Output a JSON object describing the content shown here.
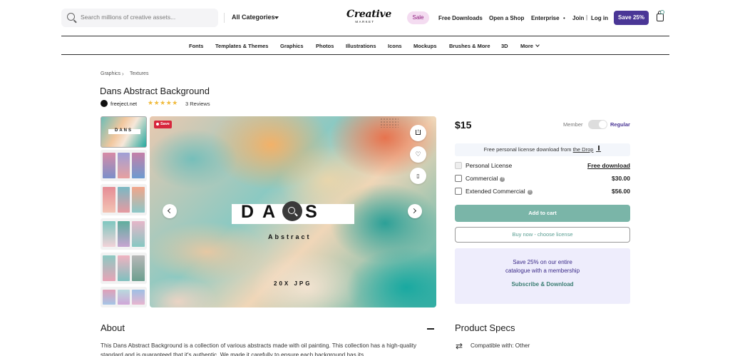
{
  "header": {
    "search_placeholder": "Search millions of creative assets...",
    "category": "All Categories",
    "logo_main": "Creative",
    "logo_sub": "MARKET",
    "sale": "Sale",
    "links": [
      "Free Downloads",
      "Open a Shop",
      "Enterprise"
    ],
    "dot": "•",
    "join": "Join",
    "pipe": "|",
    "login": "Log in",
    "save_cta": "Save 25%"
  },
  "nav": [
    "Fonts",
    "Templates & Themes",
    "Graphics",
    "Photos",
    "Illustrations",
    "Icons",
    "Mockups",
    "Brushes & More",
    "3D",
    "More"
  ],
  "breadcrumb": [
    "Graphics",
    "Textures"
  ],
  "breadcrumb_sep": "›",
  "product": {
    "title": "Dans Abstract Background",
    "shop": "freeject.net",
    "stars": "★★★★★",
    "rating": 5,
    "reviews": "3 Reviews",
    "sale_tag": "Save",
    "image_title": "DANS",
    "image_subtitle": "Abstract",
    "image_format": "20X JPG",
    "thumb_title": "DANS"
  },
  "purchase": {
    "price": "$15",
    "member_label": "Member",
    "regular_label": "Regular",
    "free_note_prefix": "Free personal license download from ",
    "free_note_link": "the Drop",
    "licenses": [
      {
        "label": "Personal License",
        "price": "Free download",
        "info": false
      },
      {
        "label": "Commercial",
        "price": "$30.00",
        "info": true
      },
      {
        "label": "Extended Commercial",
        "price": "$56.00",
        "info": true
      }
    ],
    "info_glyph": "?",
    "add_to_cart": "Add to cart",
    "buy_now": "Buy now - choose license",
    "promo_line1": "Save 25% on our entire",
    "promo_line2": "catalogue with a membership",
    "promo_link": "Subscribe & Download"
  },
  "about": {
    "heading": "About",
    "body": "This Dans Abstract Background is a collection of various abstracts made with oil painting. This collection has a high-quality standard and is guaranteed that it's authentic. We made it carefully to ensure each background has its"
  },
  "specs": {
    "heading": "Product Specs",
    "compat_icon": "⇄",
    "compat": "Compatible with: Other"
  },
  "colors": {
    "brand_purple": "#4a3696",
    "sale_pink": "#f4dcf1",
    "teal_button": "#7ab5a8",
    "promo_bg": "#eeedfc",
    "star": "#f0bb3e"
  }
}
